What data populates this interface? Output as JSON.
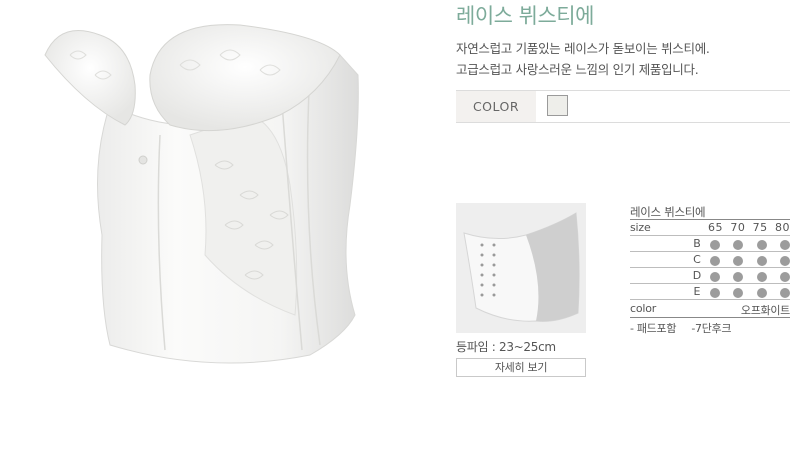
{
  "product": {
    "title": "레이스 뷔스티에",
    "description_line1": "자연스럽고 기품있는 레이스가 돋보이는 뷔스티에.",
    "description_line2": "고급스럽고 사랑스러운 느낌의 인기 제품입니다."
  },
  "color_option": {
    "label": "COLOR",
    "swatch_color": "#eeeeea"
  },
  "thumbnail": {
    "back_length_text": "등파임 : 23~25cm",
    "detail_button": "자세히 보기"
  },
  "spec": {
    "title": "레이스 뷔스티에",
    "size_label": "size",
    "sizes": [
      "65",
      "70",
      "75",
      "80"
    ],
    "cups": [
      {
        "cup": "B",
        "available": [
          true,
          true,
          true,
          true
        ]
      },
      {
        "cup": "C",
        "available": [
          true,
          true,
          true,
          true
        ]
      },
      {
        "cup": "D",
        "available": [
          true,
          true,
          true,
          true
        ]
      },
      {
        "cup": "E",
        "available": [
          true,
          true,
          true,
          true
        ]
      }
    ],
    "color_label": "color",
    "color_value": "오프화이트",
    "notes": [
      "- 패드포함",
      "-7단후크"
    ]
  },
  "colors": {
    "title": "#7dab9a",
    "dot": "#9c9c9c",
    "label_bg": "#f3f1ef"
  }
}
